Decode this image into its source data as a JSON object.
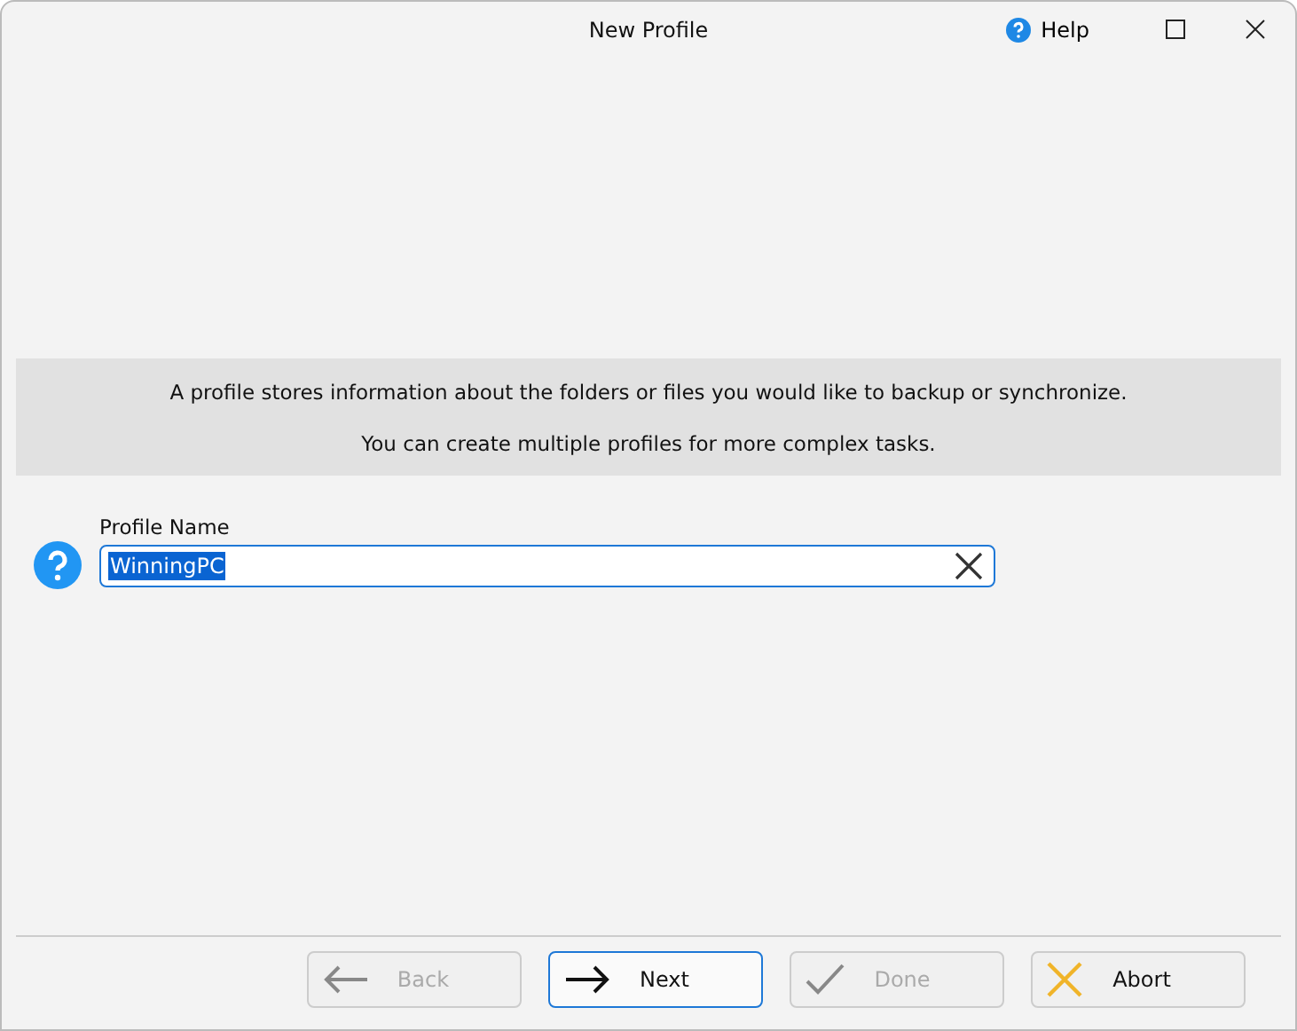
{
  "window": {
    "title": "New Profile",
    "help": "Help"
  },
  "info": [
    "A profile stores information about the folders or files you would like to backup or synchronize.",
    "You can create multiple profiles for more complex tasks."
  ],
  "profile_name": {
    "label": "Profile Name",
    "value": "WinningPC",
    "text_selected": true
  },
  "buttons": [
    {
      "kind": "back",
      "label": "Back",
      "disabled": true,
      "focused": false
    },
    {
      "kind": "next",
      "label": "Next",
      "disabled": false,
      "focused": true
    },
    {
      "kind": "done",
      "label": "Done",
      "disabled": true,
      "focused": false
    },
    {
      "kind": "abort",
      "label": "Abort",
      "disabled": false,
      "focused": false
    }
  ]
}
